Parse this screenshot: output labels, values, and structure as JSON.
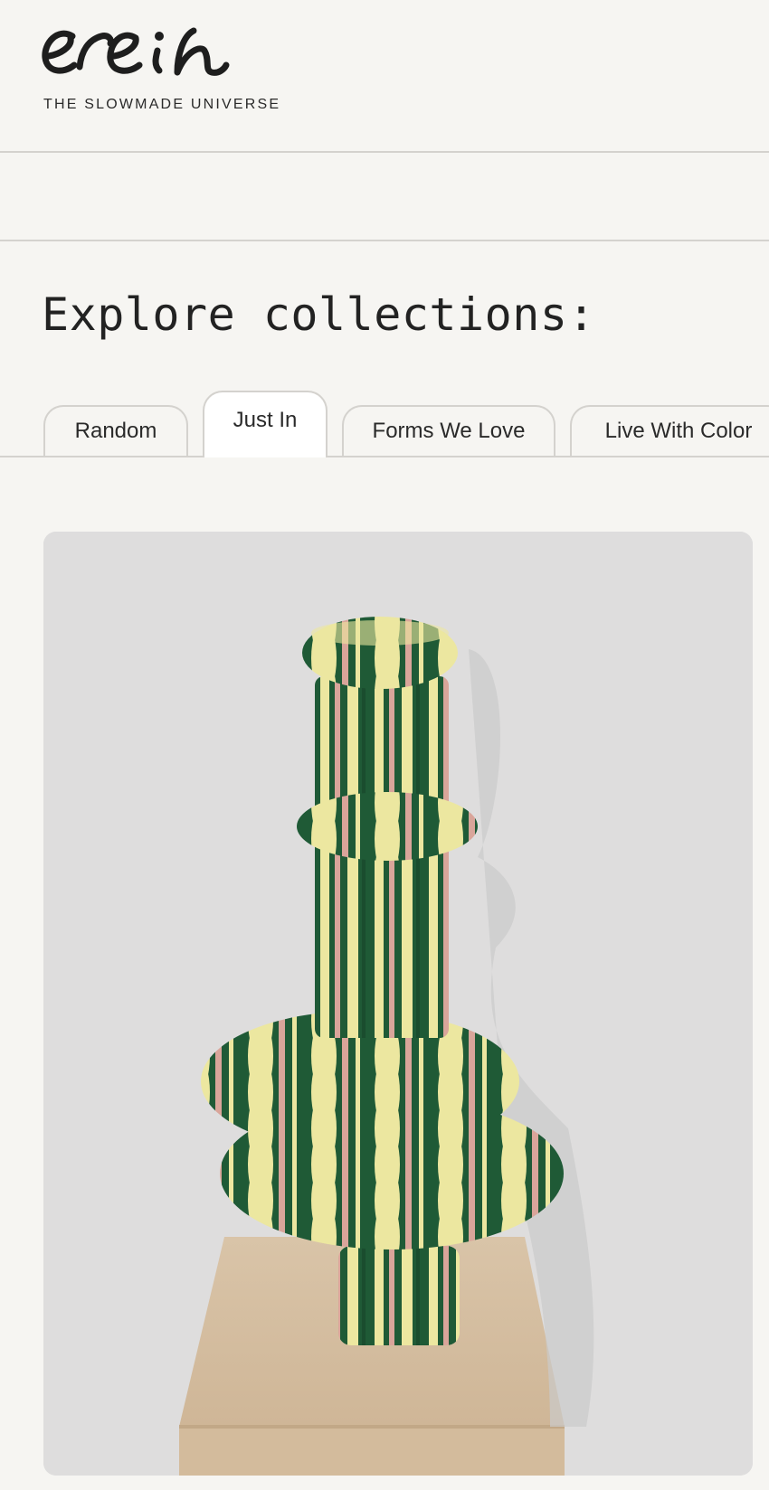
{
  "brand": {
    "logo_icon": "handwritten-logo-icon",
    "tagline": "THE SLOWMADE UNIVERSE"
  },
  "collections": {
    "heading": "Explore collections:",
    "tabs": [
      {
        "label": "Random",
        "active": false
      },
      {
        "label": "Just In",
        "active": true
      },
      {
        "label": "Forms We Love",
        "active": false
      },
      {
        "label": "Live With Color",
        "active": false
      }
    ]
  },
  "product": {
    "image_icon": "striped-sculpture-vase-image",
    "colors": {
      "background": "#dedddd",
      "green": "#1f5a36",
      "yellow": "#ece7a0",
      "pink": "#d9a59a",
      "plinth": "#d8c2a6"
    }
  }
}
